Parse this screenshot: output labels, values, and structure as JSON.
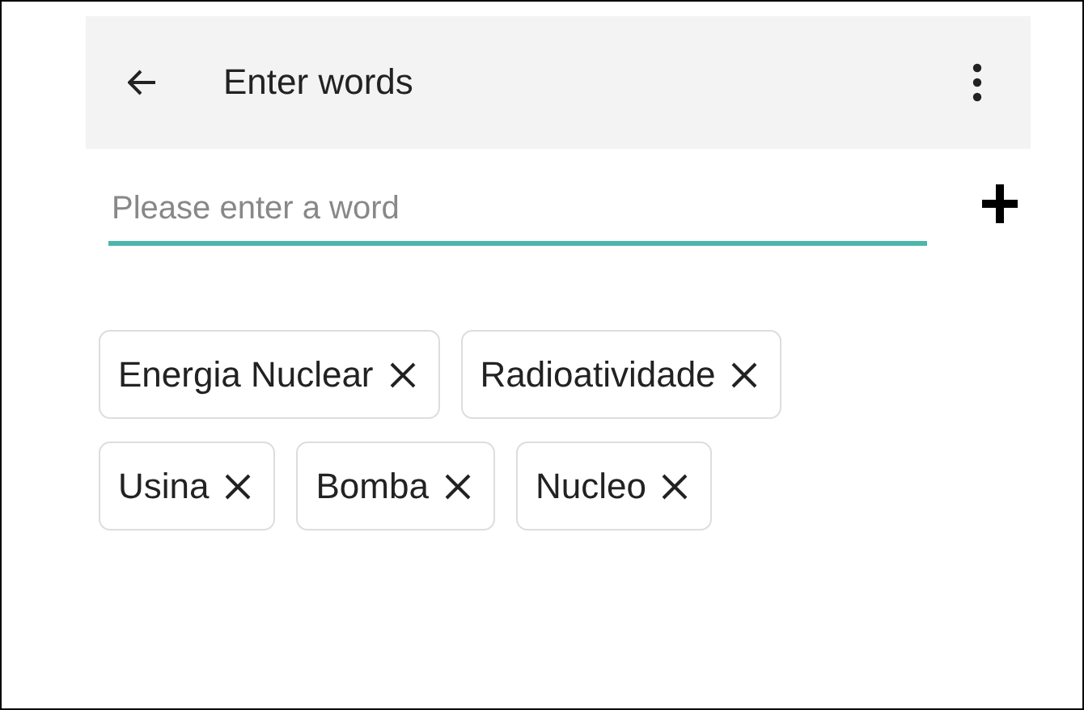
{
  "app_bar": {
    "title": "Enter words"
  },
  "word_input": {
    "placeholder": "Please enter a word"
  },
  "chips": [
    {
      "label": "Energia Nuclear"
    },
    {
      "label": "Radioatividade"
    },
    {
      "label": "Usina"
    },
    {
      "label": "Bomba"
    },
    {
      "label": "Nucleo"
    }
  ]
}
